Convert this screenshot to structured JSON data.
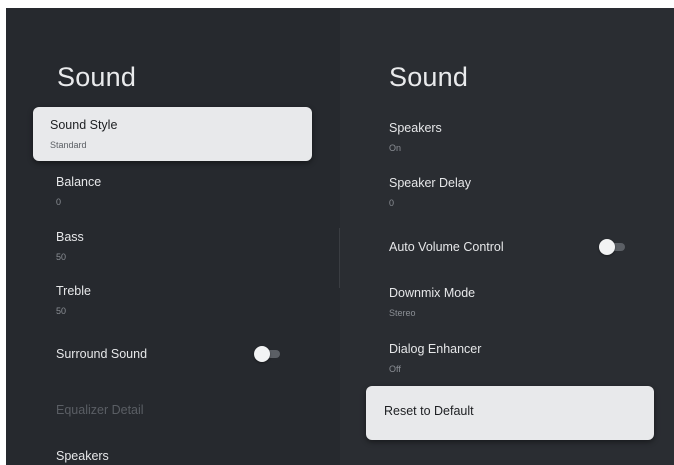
{
  "left_panel": {
    "title": "Sound",
    "items": [
      {
        "label": "Sound Style",
        "value": "Standard"
      },
      {
        "label": "Balance",
        "value": "0"
      },
      {
        "label": "Bass",
        "value": "50"
      },
      {
        "label": "Treble",
        "value": "50"
      },
      {
        "label": "Surround Sound",
        "toggle_on": false
      },
      {
        "label": "Equalizer Detail",
        "disabled": true
      },
      {
        "label": "Speakers"
      }
    ]
  },
  "right_panel": {
    "title": "Sound",
    "items": [
      {
        "label": "Speakers",
        "value": "On"
      },
      {
        "label": "Speaker Delay",
        "value": "0"
      },
      {
        "label": "Auto Volume Control",
        "toggle_on": false
      },
      {
        "label": "Downmix Mode",
        "value": "Stereo"
      },
      {
        "label": "Dialog Enhancer",
        "value": "Off"
      },
      {
        "label": "Reset to Default"
      }
    ]
  },
  "colors": {
    "background": "#26292e",
    "focus_highlight": "#e8e9eb",
    "text_primary": "#e6e7e9",
    "text_secondary": "#8b8f95",
    "text_disabled": "#5a5e64"
  }
}
